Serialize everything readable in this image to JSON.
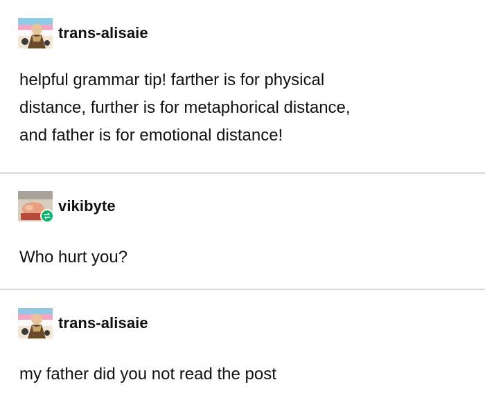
{
  "posts": [
    {
      "username": "trans-alisaie",
      "avatar_icon": "user-avatar-icon",
      "lines": [
        "helpful grammar tip! farther is for physical",
        "distance, further is for metaphorical distance,",
        "and father is for emotional distance!"
      ]
    },
    {
      "username": "vikibyte",
      "avatar_icon": "user-avatar-icon",
      "badge_icon": "reblog-icon",
      "lines": [
        "Who hurt you?"
      ]
    },
    {
      "username": "trans-alisaie",
      "avatar_icon": "user-avatar-icon",
      "lines": [
        "my father did you not read the post"
      ]
    }
  ],
  "colors": {
    "background": "#ffffff",
    "text": "#111111",
    "divider": "#d9d9d9",
    "reblog_badge": "#00b86b"
  }
}
